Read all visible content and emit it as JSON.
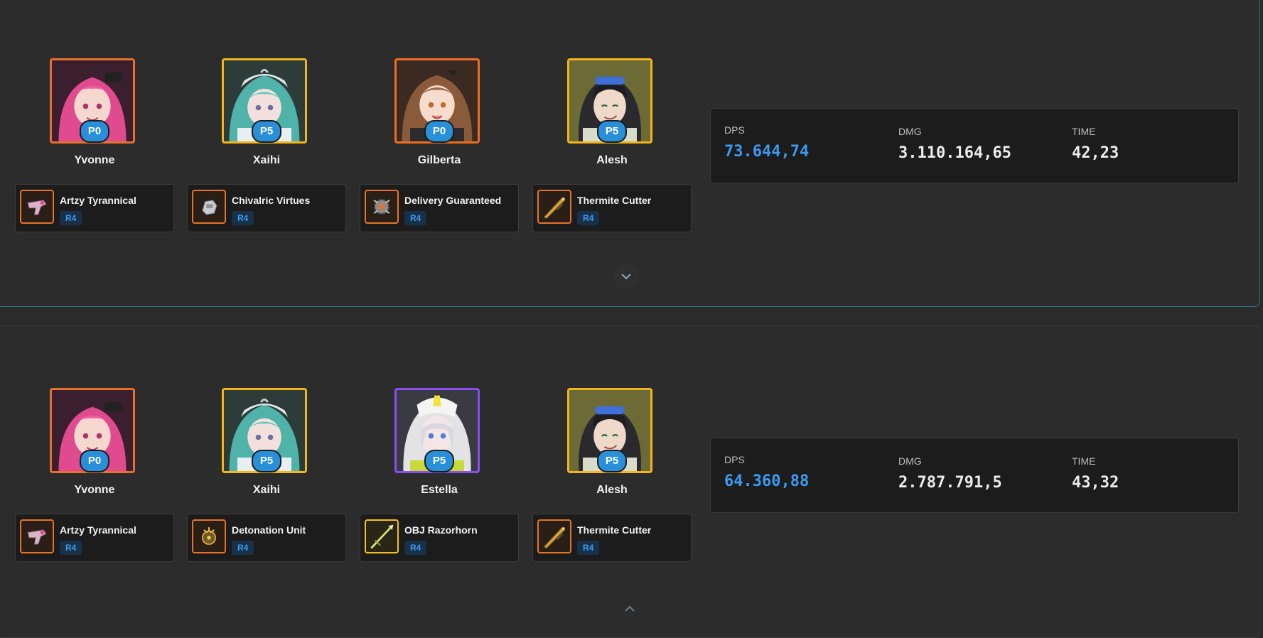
{
  "colors": {
    "accent": "#3a9bf0",
    "potential_badge": "#2a8fd9",
    "rarity_6": "#e8722b",
    "rarity_5": "#f3b51a",
    "rarity_4": "#8b4ef0",
    "card_active_border": "#2f6f86"
  },
  "stat_labels": {
    "dps": "DPS",
    "dmg": "DMG",
    "time": "TIME"
  },
  "teams": [
    {
      "units": [
        {
          "name": "Yvonne",
          "potential": "P0",
          "rarity_color": "#e8722b",
          "weapon": {
            "name": "Artzy Tyrannical",
            "rank": "R4",
            "icon": "pistol-icon"
          }
        },
        {
          "name": "Xaihi",
          "potential": "P5",
          "rarity_color": "#f3b51a",
          "weapon": {
            "name": "Chivalric Virtues",
            "rank": "R4",
            "icon": "gauntlet-icon"
          }
        },
        {
          "name": "Gilberta",
          "potential": "P0",
          "rarity_color": "#ef6c21",
          "weapon": {
            "name": "Delivery Guaranteed",
            "rank": "R4",
            "icon": "device-icon"
          }
        },
        {
          "name": "Alesh",
          "potential": "P5",
          "rarity_color": "#f3b51a",
          "weapon": {
            "name": "Thermite Cutter",
            "rank": "R4",
            "icon": "sword-icon"
          }
        }
      ],
      "stats": {
        "dps": "73.644,74",
        "dmg": "3.110.164,65",
        "time": "42,23"
      }
    },
    {
      "units": [
        {
          "name": "Yvonne",
          "potential": "P0",
          "rarity_color": "#e8722b",
          "weapon": {
            "name": "Artzy Tyrannical",
            "rank": "R4",
            "icon": "pistol-icon"
          }
        },
        {
          "name": "Xaihi",
          "potential": "P5",
          "rarity_color": "#f3b51a",
          "weapon": {
            "name": "Detonation Unit",
            "rank": "R4",
            "icon": "grenade-icon"
          }
        },
        {
          "name": "Estella",
          "potential": "P5",
          "rarity_color": "#8b4ef0",
          "weapon": {
            "name": "OBJ Razorhorn",
            "rank": "R4",
            "icon": "polearm-icon"
          }
        },
        {
          "name": "Alesh",
          "potential": "P5",
          "rarity_color": "#f3b51a",
          "weapon": {
            "name": "Thermite Cutter",
            "rank": "R4",
            "icon": "sword-icon"
          }
        }
      ],
      "stats": {
        "dps": "64.360,88",
        "dmg": "2.787.791,5",
        "time": "43,32"
      }
    }
  ]
}
